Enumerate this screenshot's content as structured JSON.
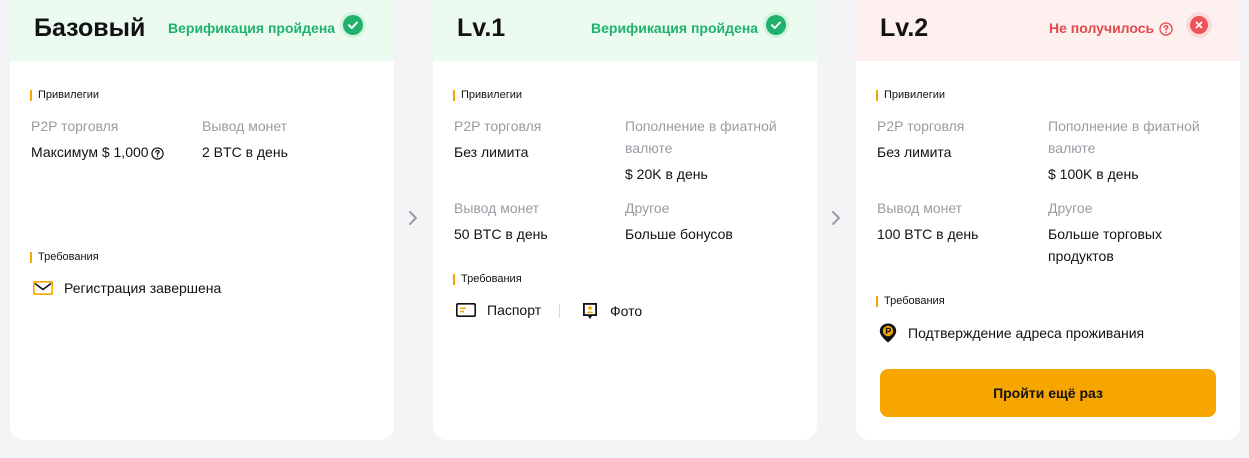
{
  "colors": {
    "accent": "#f7a600",
    "success": "#20b26c",
    "error": "#e5484d",
    "muted": "#9a9ca3"
  },
  "cards": [
    {
      "title": "Базовый",
      "status": "Верификация пройдена",
      "status_icon": "check-circle-icon",
      "privileges_title": "Привилегии",
      "privileges": [
        {
          "label": "P2P торговля",
          "value": "Максимум $ 1,000"
        },
        {
          "label": "Вывод монет",
          "value": "2 BTC в день"
        }
      ],
      "requirements_title": "Требования",
      "requirements": [
        {
          "icon": "email-icon",
          "label": "Регистрация завершена"
        }
      ]
    },
    {
      "title": "Lv.1",
      "status": "Верификация пройдена",
      "status_icon": "check-circle-icon",
      "privileges_title": "Привилегии",
      "privileges": [
        {
          "label": "P2P торговля",
          "value": "Без лимита"
        },
        {
          "label": "Пополнение в фиатной валюте",
          "value": "$ 20K в день"
        },
        {
          "label": "Вывод монет",
          "value": "50 BTC в день"
        },
        {
          "label": "Другое",
          "value": "Больше бонусов"
        }
      ],
      "requirements_title": "Требования",
      "requirements": [
        {
          "icon": "id-card-icon",
          "label": "Паспорт"
        },
        {
          "icon": "photo-icon",
          "label": "Фото"
        }
      ]
    },
    {
      "title": "Lv.2",
      "status": "Не получилось",
      "status_icon": "close-circle-icon",
      "privileges_title": "Привилегии",
      "privileges": [
        {
          "label": "P2P торговля",
          "value": "Без лимита"
        },
        {
          "label": "Пополнение в фиатной валюте",
          "value": "$ 100K в день"
        },
        {
          "label": "Вывод монет",
          "value": "100 BTC в день"
        },
        {
          "label": "Другое",
          "value": "Больше торговых продуктов"
        }
      ],
      "requirements_title": "Требования",
      "requirements": [
        {
          "icon": "location-pin-icon",
          "label": "Подтверждение адреса проживания"
        }
      ],
      "cta": "Пройти ещё раз"
    }
  ]
}
